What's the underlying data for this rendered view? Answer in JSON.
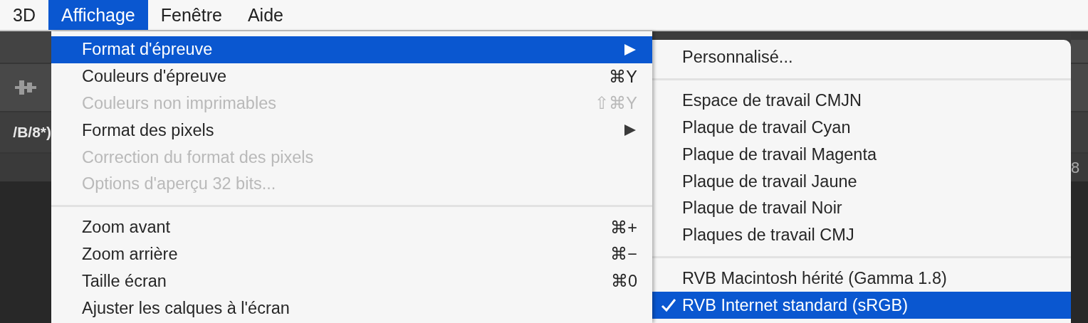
{
  "menubar": [
    {
      "label": "3D",
      "selected": false
    },
    {
      "label": "Affichage",
      "selected": true
    },
    {
      "label": "Fenêtre",
      "selected": false
    },
    {
      "label": "Aide",
      "selected": false
    }
  ],
  "background": {
    "document_tab_text": "/B/8*)",
    "ruler_text": "8"
  },
  "menu": [
    {
      "kind": "item",
      "label": "Format d'épreuve",
      "submenu": true,
      "disabled": false,
      "selected": true
    },
    {
      "kind": "item",
      "label": "Couleurs d'épreuve",
      "shortcut": "⌘Y",
      "submenu": false,
      "disabled": false,
      "selected": false
    },
    {
      "kind": "item",
      "label": "Couleurs non imprimables",
      "shortcut": "⇧⌘Y",
      "submenu": false,
      "disabled": true,
      "selected": false
    },
    {
      "kind": "item",
      "label": "Format des pixels",
      "submenu": true,
      "disabled": false,
      "selected": false
    },
    {
      "kind": "item",
      "label": "Correction du format des pixels",
      "submenu": false,
      "disabled": true,
      "selected": false
    },
    {
      "kind": "item",
      "label": "Options d'aperçu 32 bits...",
      "submenu": false,
      "disabled": true,
      "selected": false
    },
    {
      "kind": "separator"
    },
    {
      "kind": "item",
      "label": "Zoom avant",
      "shortcut": "⌘+",
      "submenu": false,
      "disabled": false,
      "selected": false
    },
    {
      "kind": "item",
      "label": "Zoom arrière",
      "shortcut": "⌘−",
      "submenu": false,
      "disabled": false,
      "selected": false
    },
    {
      "kind": "item",
      "label": "Taille écran",
      "shortcut": "⌘0",
      "submenu": false,
      "disabled": false,
      "selected": false
    },
    {
      "kind": "item",
      "label": "Ajuster les calques à l'écran",
      "submenu": false,
      "disabled": false,
      "selected": false
    }
  ],
  "submenu": [
    {
      "kind": "item",
      "label": "Personnalisé...",
      "checked": false,
      "selected": false
    },
    {
      "kind": "separator"
    },
    {
      "kind": "item",
      "label": "Espace de travail CMJN",
      "checked": false,
      "selected": false
    },
    {
      "kind": "item",
      "label": "Plaque de travail Cyan",
      "checked": false,
      "selected": false
    },
    {
      "kind": "item",
      "label": "Plaque de travail Magenta",
      "checked": false,
      "selected": false
    },
    {
      "kind": "item",
      "label": "Plaque de travail Jaune",
      "checked": false,
      "selected": false
    },
    {
      "kind": "item",
      "label": "Plaque de travail Noir",
      "checked": false,
      "selected": false
    },
    {
      "kind": "item",
      "label": "Plaques de travail CMJ",
      "checked": false,
      "selected": false
    },
    {
      "kind": "separator"
    },
    {
      "kind": "item",
      "label": "RVB Macintosh hérité (Gamma 1.8)",
      "checked": false,
      "selected": false
    },
    {
      "kind": "item",
      "label": "RVB Internet standard (sRGB)",
      "checked": true,
      "selected": true
    }
  ]
}
